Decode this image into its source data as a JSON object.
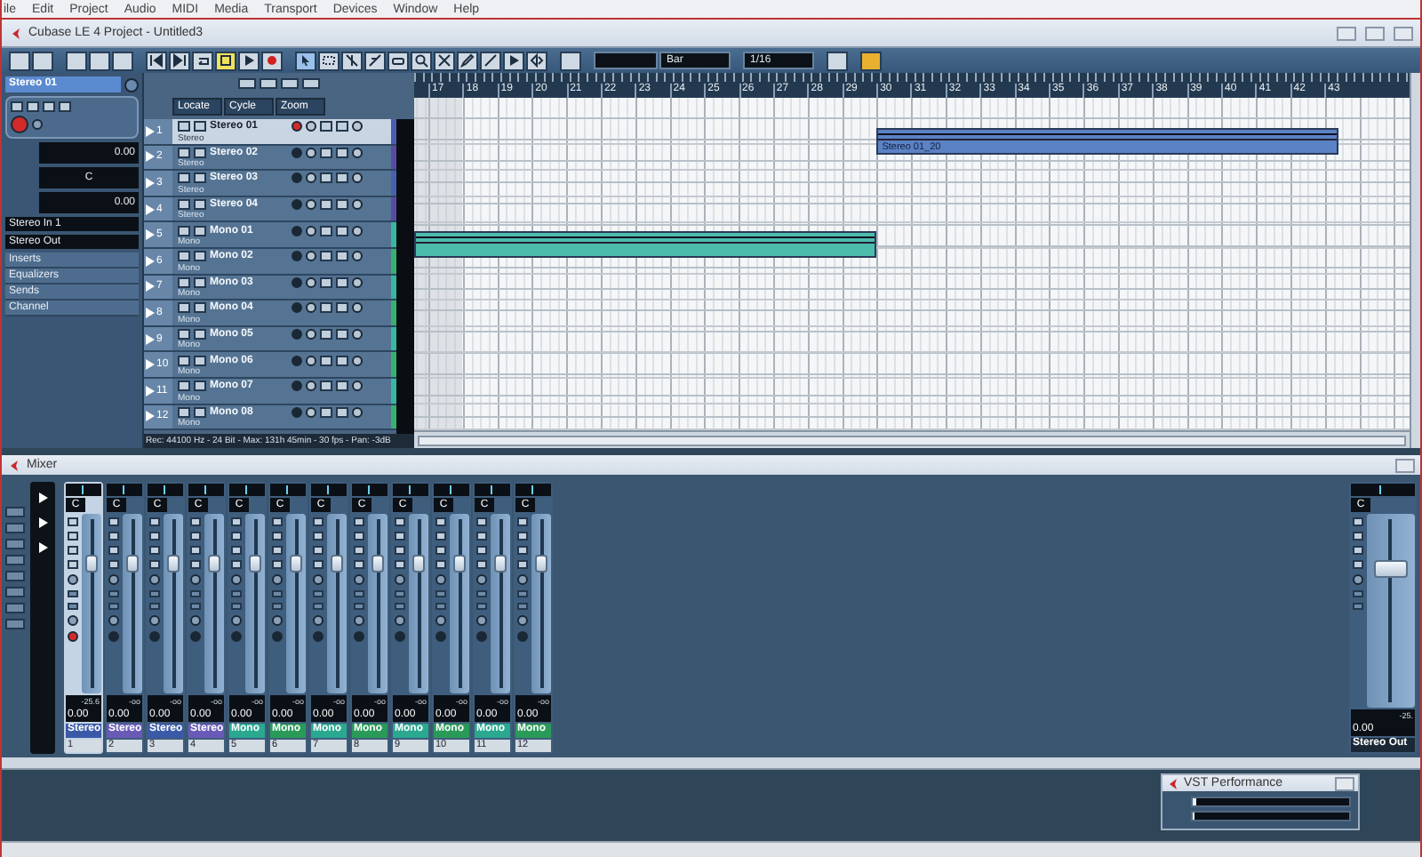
{
  "menu": [
    "ile",
    "Edit",
    "Project",
    "Audio",
    "MIDI",
    "Media",
    "Transport",
    "Devices",
    "Window",
    "Help"
  ],
  "window": {
    "title": "Cubase LE 4 Project - Untitled3"
  },
  "transport": [
    {
      "kind": "rewind",
      "selected": false
    },
    {
      "kind": "forward",
      "selected": false
    },
    {
      "kind": "cycle",
      "selected": false
    },
    {
      "kind": "stop",
      "selected": true
    },
    {
      "kind": "play",
      "selected": false
    },
    {
      "kind": "record",
      "selected": false
    }
  ],
  "tools": [
    {
      "kind": "arrow",
      "selected": true
    },
    {
      "kind": "range",
      "selected": false
    },
    {
      "kind": "split",
      "selected": false
    },
    {
      "kind": "glue",
      "selected": false
    },
    {
      "kind": "erase",
      "selected": false
    },
    {
      "kind": "zoom",
      "selected": false
    },
    {
      "kind": "mute",
      "selected": false
    },
    {
      "kind": "draw",
      "selected": false
    },
    {
      "kind": "line",
      "selected": false
    },
    {
      "kind": "play",
      "selected": false
    },
    {
      "kind": "scrub",
      "selected": false
    }
  ],
  "grid": {
    "type": "Bar",
    "quantize": "1/16"
  },
  "inspector": {
    "track": "Stereo 01",
    "record_enabled": true,
    "volume": "0.00",
    "pan": "C",
    "delay": "0.00",
    "input": "Stereo In 1",
    "output": "Stereo Out",
    "sections": [
      "Inserts",
      "Equalizers",
      "Sends",
      "Channel"
    ]
  },
  "track_header": {
    "dropdowns": [
      "Locate",
      "Cycle",
      "Zoom"
    ]
  },
  "tracks": [
    {
      "number": "1",
      "name": "Stereo 01",
      "type": "Stereo",
      "selected": true,
      "record_enabled": true,
      "color": "#4a5fb0"
    },
    {
      "number": "2",
      "name": "Stereo 02",
      "type": "Stereo",
      "selected": false,
      "record_enabled": false,
      "color": "#5a4aa8"
    },
    {
      "number": "3",
      "name": "Stereo 03",
      "type": "Stereo",
      "selected": false,
      "record_enabled": false,
      "color": "#4a5fb0"
    },
    {
      "number": "4",
      "name": "Stereo 04",
      "type": "Stereo",
      "selected": false,
      "record_enabled": false,
      "color": "#5a4aa8"
    },
    {
      "number": "5",
      "name": "Mono 01",
      "type": "Mono",
      "selected": false,
      "record_enabled": false,
      "color": "#38b8a0"
    },
    {
      "number": "6",
      "name": "Mono 02",
      "type": "Mono",
      "selected": false,
      "record_enabled": false,
      "color": "#38b070"
    },
    {
      "number": "7",
      "name": "Mono 03",
      "type": "Mono",
      "selected": false,
      "record_enabled": false,
      "color": "#38b8a0"
    },
    {
      "number": "8",
      "name": "Mono 04",
      "type": "Mono",
      "selected": false,
      "record_enabled": false,
      "color": "#38b070"
    },
    {
      "number": "9",
      "name": "Mono 05",
      "type": "Mono",
      "selected": false,
      "record_enabled": false,
      "color": "#38b8a0"
    },
    {
      "number": "10",
      "name": "Mono 06",
      "type": "Mono",
      "selected": false,
      "record_enabled": false,
      "color": "#38b070"
    },
    {
      "number": "11",
      "name": "Mono 07",
      "type": "Mono",
      "selected": false,
      "record_enabled": false,
      "color": "#38b8a0"
    },
    {
      "number": "12",
      "name": "Mono 08",
      "type": "Mono",
      "selected": false,
      "record_enabled": false,
      "color": "#38b070"
    }
  ],
  "status": "Rec: 44100 Hz - 24 Bit - Max: 131h 45min - 30 fps - Pan: -3dB",
  "ruler": [
    "17",
    "18",
    "19",
    "20",
    "21",
    "22",
    "23",
    "24",
    "25",
    "26",
    "27",
    "28",
    "29",
    "30",
    "31",
    "32",
    "33",
    "34",
    "35",
    "36",
    "37",
    "38",
    "39",
    "40",
    "41",
    "42",
    "43"
  ],
  "events": [
    {
      "kind": "stereo",
      "label": "Stereo 01_20"
    },
    {
      "kind": "mono"
    }
  ],
  "mixer": {
    "title": "Mixer",
    "channels": [
      {
        "name": "Stereo",
        "number": "1",
        "pan": "C",
        "value": "0.00",
        "peak": "-25.6",
        "level": 0.72,
        "selected": true,
        "record_enabled": true,
        "color": "#3a5aa8"
      },
      {
        "name": "Stereo",
        "number": "2",
        "pan": "C",
        "value": "0.00",
        "peak": "-oo",
        "level": 0.72,
        "selected": false,
        "record_enabled": false,
        "color": "#6a5ab8"
      },
      {
        "name": "Stereo",
        "number": "3",
        "pan": "C",
        "value": "0.00",
        "peak": "-oo",
        "level": 0.72,
        "selected": false,
        "record_enabled": false,
        "color": "#3a5aa8"
      },
      {
        "name": "Stereo",
        "number": "4",
        "pan": "C",
        "value": "0.00",
        "peak": "-oo",
        "level": 0.72,
        "selected": false,
        "record_enabled": false,
        "color": "#6a5ab8"
      },
      {
        "name": "Mono",
        "number": "5",
        "pan": "C",
        "value": "0.00",
        "peak": "-oo",
        "level": 0.72,
        "selected": false,
        "record_enabled": false,
        "color": "#2aa890"
      },
      {
        "name": "Mono",
        "number": "6",
        "pan": "C",
        "value": "0.00",
        "peak": "-oo",
        "level": 0.72,
        "selected": false,
        "record_enabled": false,
        "color": "#2a9a58"
      },
      {
        "name": "Mono",
        "number": "7",
        "pan": "C",
        "value": "0.00",
        "peak": "-oo",
        "level": 0.72,
        "selected": false,
        "record_enabled": false,
        "color": "#2aa890"
      },
      {
        "name": "Mono",
        "number": "8",
        "pan": "C",
        "value": "0.00",
        "peak": "-oo",
        "level": 0.72,
        "selected": false,
        "record_enabled": false,
        "color": "#2a9a58"
      },
      {
        "name": "Mono",
        "number": "9",
        "pan": "C",
        "value": "0.00",
        "peak": "-oo",
        "level": 0.72,
        "selected": false,
        "record_enabled": false,
        "color": "#2aa890"
      },
      {
        "name": "Mono",
        "number": "10",
        "pan": "C",
        "value": "0.00",
        "peak": "-oo",
        "level": 0.72,
        "selected": false,
        "record_enabled": false,
        "color": "#2a9a58"
      },
      {
        "name": "Mono",
        "number": "11",
        "pan": "C",
        "value": "0.00",
        "peak": "-oo",
        "level": 0.72,
        "selected": false,
        "record_enabled": false,
        "color": "#2aa890"
      },
      {
        "name": "Mono",
        "number": "12",
        "pan": "C",
        "value": "0.00",
        "peak": "-oo",
        "level": 0.72,
        "selected": false,
        "record_enabled": false,
        "color": "#2a9a58"
      }
    ],
    "output": {
      "name": "Stereo Out",
      "pan": "C",
      "value": "0.00",
      "peak": "-25.",
      "level": 0.72
    }
  },
  "vst_performance": {
    "title": "VST Performance",
    "meters": [
      {
        "level": 0.02
      },
      {
        "level": 0.01
      }
    ]
  }
}
